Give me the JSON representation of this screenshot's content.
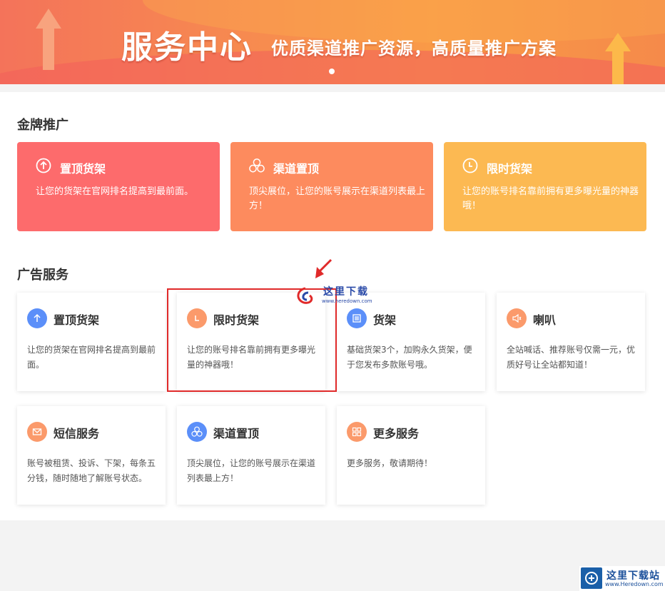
{
  "banner": {
    "title": "服务中心",
    "subtitle": "优质渠道推广资源，高质量推广方案"
  },
  "gold": {
    "section_title": "金牌推广",
    "cards": [
      {
        "title": "置顶货架",
        "desc": "让您的货架在官网排名提高到最前面。",
        "icon": "arrow-up-circle-icon",
        "color": "#fd6b6c"
      },
      {
        "title": "渠道置顶",
        "desc": "顶尖展位，让您的账号展示在渠道列表最上方！",
        "icon": "three-circles-icon",
        "color": "#fd8b5e"
      },
      {
        "title": "限时货架",
        "desc": "让您的账号排名靠前拥有更多曝光量的神器哦！",
        "icon": "clock-icon",
        "color": "#fcb952"
      }
    ]
  },
  "ads": {
    "section_title": "广告服务",
    "cards": [
      {
        "title": "置顶货架",
        "desc": "让您的货架在官网排名提高到最前面。",
        "icon": "arrow-up-icon",
        "color": "#5b8ff9"
      },
      {
        "title": "限时货架",
        "desc": "让您的账号排名靠前拥有更多曝光量的神器哦！",
        "icon": "clock-icon",
        "color": "#fb9a6b"
      },
      {
        "title": "货架",
        "desc": "基础货架3个，加购永久货架，便于您发布多款账号哦。",
        "icon": "list-icon",
        "color": "#5b8ff9"
      },
      {
        "title": "喇叭",
        "desc": "全站喊话、推荐账号仅需一元，优质好号让全站都知道！",
        "icon": "speaker-icon",
        "color": "#fb9a6b"
      },
      {
        "title": "短信服务",
        "desc": "账号被租赁、投诉、下架，每条五分钱，随时随地了解账号状态。",
        "icon": "mail-icon",
        "color": "#fb9a6b"
      },
      {
        "title": "渠道置顶",
        "desc": "顶尖展位，让您的账号展示在渠道列表最上方！",
        "icon": "three-circles-icon",
        "color": "#5b8ff9"
      },
      {
        "title": "更多服务",
        "desc": "更多服务，敬请期待！",
        "icon": "grid-icon",
        "color": "#fb9a6b"
      }
    ]
  },
  "watermark": {
    "center_text": "这里下载",
    "center_url": "www.heredown.com",
    "corner_text": "这里下载站",
    "corner_url": "www.Heredown.com"
  }
}
